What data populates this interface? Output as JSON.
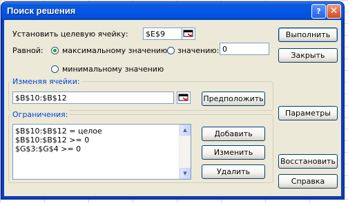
{
  "window": {
    "title": "Поиск решения",
    "help_glyph": "?",
    "close_glyph": "✕"
  },
  "target": {
    "label": "Установить целевую ячейку:",
    "value": "$E$9"
  },
  "equal": {
    "label": "Равной:",
    "max_label": "максимальному значению",
    "value_label": "значению:",
    "value_input": "0",
    "min_label": "минимальному значению",
    "selected": "max"
  },
  "changing": {
    "legend": "Изменяя ячейки:",
    "value": "$B$10:$B$12",
    "guess_label": "Предположить"
  },
  "constraints": {
    "legend": "Ограничения:",
    "items": [
      "$B$10:$B$12 = целое",
      "$B$10:$B$12 >= 0",
      "$G$3:$G$4 >= 0"
    ],
    "add_label": "Добавить",
    "change_label": "Изменить",
    "delete_label": "Удалить"
  },
  "buttons": {
    "solve": "Выполнить",
    "close": "Закрыть",
    "options": "Параметры",
    "reset": "Восстановить",
    "help": "Справка"
  },
  "icons": {
    "ref_picker": "cell-range-picker-icon",
    "scroll_up": "▲",
    "scroll_down": "▼"
  },
  "colors": {
    "title_bar": "#0557e6",
    "dialog_face": "#ece9d8",
    "group_legend": "#0046d5",
    "radio_dot": "#21a121"
  }
}
